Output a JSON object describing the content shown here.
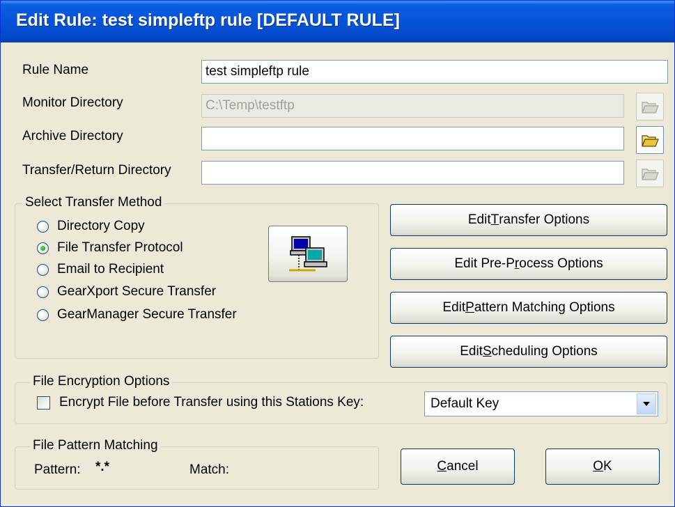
{
  "window": {
    "title": "Edit Rule: test simpleftp rule [DEFAULT RULE]"
  },
  "fields": {
    "rule_name": {
      "label": "Rule Name",
      "value": "test simpleftp rule"
    },
    "monitor_directory": {
      "label": "Monitor Directory",
      "value": "C:\\Temp\\testftp"
    },
    "archive_directory": {
      "label": "Archive Directory",
      "value": ""
    },
    "transfer_return_directory": {
      "label": "Transfer/Return Directory",
      "value": ""
    }
  },
  "transfer_method": {
    "legend": "Select Transfer Method",
    "options": [
      {
        "label": "Directory Copy",
        "selected": false
      },
      {
        "label": "File Transfer Protocol",
        "selected": true
      },
      {
        "label": "Email to Recipient",
        "selected": false
      },
      {
        "label": "GearXport Secure Transfer",
        "selected": false
      },
      {
        "label": "GearManager Secure Transfer",
        "selected": false
      }
    ]
  },
  "option_buttons": {
    "transfer": {
      "pre": "Edit ",
      "key": "T",
      "post": "ransfer Options"
    },
    "preprocess": {
      "pre": "Edit Pre-P",
      "key": "r",
      "post": "ocess Options"
    },
    "pattern": {
      "pre": "Edit ",
      "key": "P",
      "post": "attern Matching Options"
    },
    "scheduling": {
      "pre": "Edit ",
      "key": "S",
      "post": "cheduling Options"
    }
  },
  "encryption": {
    "legend": "File Encryption Options",
    "checkbox_label": "Encrypt File before Transfer using this Stations Key:",
    "checked": false,
    "key_select": "Default Key"
  },
  "pattern_matching": {
    "legend": "File Pattern Matching",
    "pattern_label": "Pattern:",
    "pattern_value": "*.*",
    "match_label": "Match:",
    "match_value": ""
  },
  "dialog_buttons": {
    "cancel": {
      "key": "C",
      "post": "ancel"
    },
    "ok": {
      "key": "O",
      "post": "K"
    }
  },
  "icons": {
    "folder": "folder-open-icon",
    "network": "network-computers-icon",
    "dropdown": "chevron-down-icon"
  }
}
